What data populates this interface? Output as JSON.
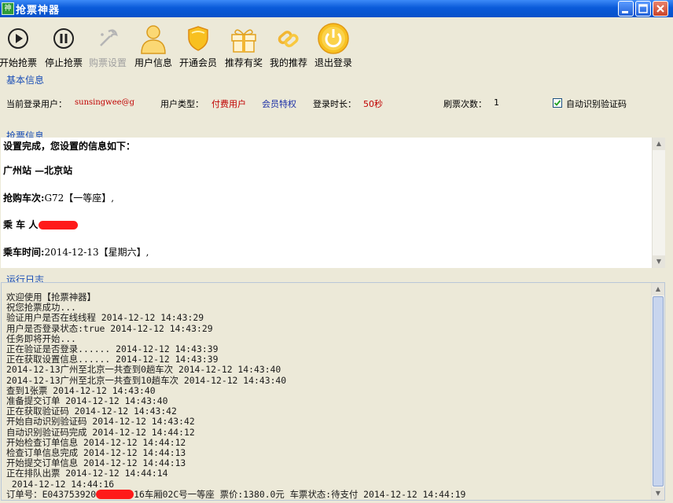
{
  "window": {
    "title": "抢票神器",
    "icon": "app-icon"
  },
  "toolbar": [
    {
      "name": "start-grab-button",
      "icon": "play-icon",
      "label": "开始抢票",
      "enabled": true
    },
    {
      "name": "stop-grab-button",
      "icon": "pause-icon",
      "label": "停止抢票",
      "enabled": true
    },
    {
      "name": "ticket-settings-button",
      "icon": "settings-icon",
      "label": "购票设置",
      "enabled": false
    },
    {
      "name": "user-info-button",
      "icon": "user-icon",
      "label": "用户信息",
      "enabled": true
    },
    {
      "name": "open-membership-button",
      "icon": "shield-icon",
      "label": "开通会员",
      "enabled": true
    },
    {
      "name": "refer-reward-button",
      "icon": "gift-icon",
      "label": "推荐有奖",
      "enabled": true
    },
    {
      "name": "my-referrals-button",
      "icon": "link-icon",
      "label": "我的推荐",
      "enabled": true
    },
    {
      "name": "logout-button",
      "icon": "power-icon",
      "label": "退出登录",
      "enabled": true
    }
  ],
  "basic": {
    "heading": "基本信息",
    "user_label": "当前登录用户：",
    "user_value": "sunsingwee@g",
    "type_label": "用户类型：",
    "type_value": "付费用户",
    "member_link": "会员特权",
    "duration_label": "登录时长：",
    "duration_value": "50秒",
    "refresh_label": "刷票次数：",
    "refresh_value": "1",
    "auto_captcha_label": "自动识别验证码",
    "auto_captcha_checked": true
  },
  "ticket": {
    "heading": "抢票信息",
    "line1": "设置完成，您设置的信息如下：",
    "route": "广州站 —北京站",
    "train_label": "抢购车次:",
    "train_value": "G72【一等座】,",
    "passenger_label": "乘 车 人",
    "date_label": "乘车时间:",
    "date_value": "2014-12-13【星期六】,"
  },
  "runlog": {
    "heading": "运行日志",
    "lines": [
      "欢迎使用【抢票神器】",
      "祝您抢票成功...",
      "验证用户是否在线线程 2014-12-12 14:43:29",
      "用户是否登录状态:true 2014-12-12 14:43:29",
      "任务即将开始...",
      "正在验证是否登录...... 2014-12-12 14:43:39",
      "正在获取设置信息...... 2014-12-12 14:43:39",
      "2014-12-13广州至北京一共查到0趟车次 2014-12-12 14:43:40",
      "2014-12-13广州至北京一共查到10趟车次 2014-12-12 14:43:40",
      "查到1张票 2014-12-12 14:43:40",
      "准备提交订单 2014-12-12 14:43:40",
      "正在获取验证码 2014-12-12 14:43:42",
      "开始自动识别验证码 2014-12-12 14:43:42",
      "自动识别验证码完成 2014-12-12 14:44:12",
      "开始检查订单信息 2014-12-12 14:44:12",
      "检查订单信息完成 2014-12-12 14:44:13",
      "开始提交订单信息 2014-12-12 14:44:13",
      "正在排队出票 2014-12-12 14:44:14",
      " 2014-12-12 14:44:16"
    ],
    "order_prefix": "订单号：E043753920",
    "order_suffix": "16车厢02C号一等座 票价:1380.0元 车票状态:待支付 2014-12-12 14:44:19"
  }
}
